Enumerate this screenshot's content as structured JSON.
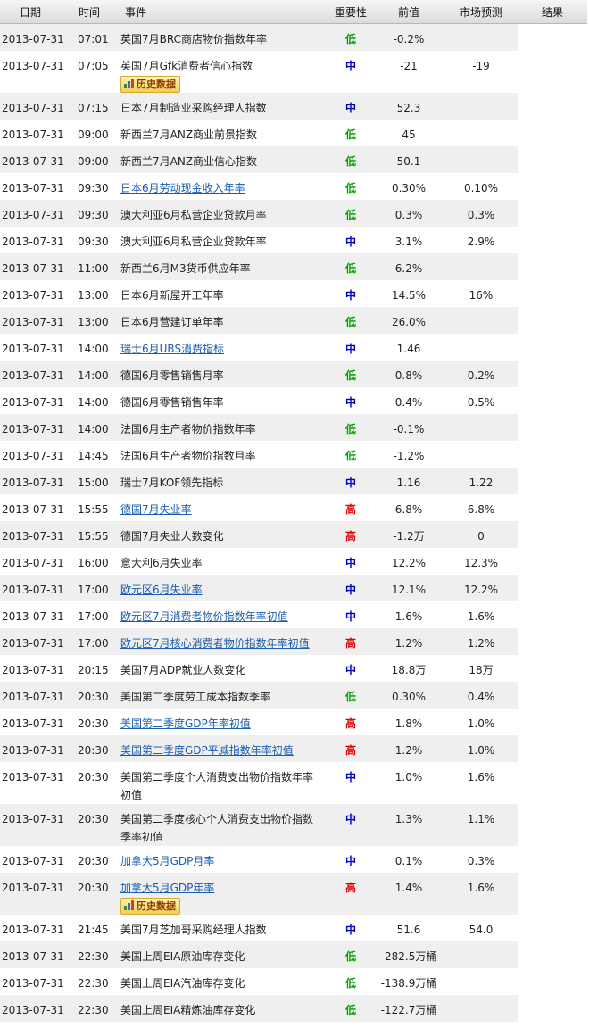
{
  "header": {
    "date": "日期",
    "time": "时间",
    "event": "事件",
    "importance": "重要性",
    "previous": "前值",
    "forecast": "市场预测",
    "result": "结果"
  },
  "history_label": "历史数据",
  "rows": [
    {
      "date": "2013-07-31",
      "time": "07:01",
      "event": "英国7月BRC商店物价指数年率",
      "link": false,
      "imp": "低",
      "lvl": "low",
      "prev": "-0.2%",
      "fc": "",
      "res": ""
    },
    {
      "date": "2013-07-31",
      "time": "07:05",
      "event": "英国7月Gfk消费者信心指数",
      "link": false,
      "imp": "中",
      "lvl": "mid",
      "prev": "-21",
      "fc": "-19",
      "res": "",
      "hist": true
    },
    {
      "date": "2013-07-31",
      "time": "07:15",
      "event": "日本7月制造业采购经理人指数",
      "link": false,
      "imp": "中",
      "lvl": "mid",
      "prev": "52.3",
      "fc": "",
      "res": ""
    },
    {
      "date": "2013-07-31",
      "time": "09:00",
      "event": "新西兰7月ANZ商业前景指数",
      "link": false,
      "imp": "低",
      "lvl": "low",
      "prev": "45",
      "fc": "",
      "res": ""
    },
    {
      "date": "2013-07-31",
      "time": "09:00",
      "event": "新西兰7月ANZ商业信心指数",
      "link": false,
      "imp": "低",
      "lvl": "low",
      "prev": "50.1",
      "fc": "",
      "res": ""
    },
    {
      "date": "2013-07-31",
      "time": "09:30",
      "event": "日本6月劳动现金收入年率",
      "link": true,
      "imp": "低",
      "lvl": "low",
      "prev": "0.30%",
      "fc": "0.10%",
      "res": ""
    },
    {
      "date": "2013-07-31",
      "time": "09:30",
      "event": "澳大利亚6月私营企业贷款月率",
      "link": false,
      "imp": "低",
      "lvl": "low",
      "prev": "0.3%",
      "fc": "0.3%",
      "res": ""
    },
    {
      "date": "2013-07-31",
      "time": "09:30",
      "event": "澳大利亚6月私营企业贷款年率",
      "link": false,
      "imp": "中",
      "lvl": "mid",
      "prev": "3.1%",
      "fc": "2.9%",
      "res": ""
    },
    {
      "date": "2013-07-31",
      "time": "11:00",
      "event": "新西兰6月M3货币供应年率",
      "link": false,
      "imp": "低",
      "lvl": "low",
      "prev": "6.2%",
      "fc": "",
      "res": ""
    },
    {
      "date": "2013-07-31",
      "time": "13:00",
      "event": "日本6月新屋开工年率",
      "link": false,
      "imp": "中",
      "lvl": "mid",
      "prev": "14.5%",
      "fc": "16%",
      "res": ""
    },
    {
      "date": "2013-07-31",
      "time": "13:00",
      "event": "日本6月营建订单年率",
      "link": false,
      "imp": "低",
      "lvl": "low",
      "prev": "26.0%",
      "fc": "",
      "res": ""
    },
    {
      "date": "2013-07-31",
      "time": "14:00",
      "event": "瑞士6月UBS消费指标",
      "link": true,
      "imp": "中",
      "lvl": "mid",
      "prev": "1.46",
      "fc": "",
      "res": ""
    },
    {
      "date": "2013-07-31",
      "time": "14:00",
      "event": "德国6月零售销售月率",
      "link": false,
      "imp": "低",
      "lvl": "low",
      "prev": "0.8%",
      "fc": "0.2%",
      "res": ""
    },
    {
      "date": "2013-07-31",
      "time": "14:00",
      "event": "德国6月零售销售年率",
      "link": false,
      "imp": "中",
      "lvl": "mid",
      "prev": "0.4%",
      "fc": "0.5%",
      "res": ""
    },
    {
      "date": "2013-07-31",
      "time": "14:00",
      "event": "法国6月生产者物价指数年率",
      "link": false,
      "imp": "低",
      "lvl": "low",
      "prev": "-0.1%",
      "fc": "",
      "res": ""
    },
    {
      "date": "2013-07-31",
      "time": "14:45",
      "event": "法国6月生产者物价指数月率",
      "link": false,
      "imp": "低",
      "lvl": "low",
      "prev": "-1.2%",
      "fc": "",
      "res": ""
    },
    {
      "date": "2013-07-31",
      "time": "15:00",
      "event": "瑞士7月KOF领先指标",
      "link": false,
      "imp": "中",
      "lvl": "mid",
      "prev": "1.16",
      "fc": "1.22",
      "res": ""
    },
    {
      "date": "2013-07-31",
      "time": "15:55",
      "event": "德国7月失业率",
      "link": true,
      "imp": "高",
      "lvl": "high",
      "prev": "6.8%",
      "fc": "6.8%",
      "res": ""
    },
    {
      "date": "2013-07-31",
      "time": "15:55",
      "event": "德国7月失业人数变化",
      "link": false,
      "imp": "高",
      "lvl": "high",
      "prev": "-1.2万",
      "fc": "0",
      "res": ""
    },
    {
      "date": "2013-07-31",
      "time": "16:00",
      "event": "意大利6月失业率",
      "link": false,
      "imp": "中",
      "lvl": "mid",
      "prev": "12.2%",
      "fc": "12.3%",
      "res": ""
    },
    {
      "date": "2013-07-31",
      "time": "17:00",
      "event": "欧元区6月失业率",
      "link": true,
      "imp": "中",
      "lvl": "mid",
      "prev": "12.1%",
      "fc": "12.2%",
      "res": ""
    },
    {
      "date": "2013-07-31",
      "time": "17:00",
      "event": "欧元区7月消费者物价指数年率初值",
      "link": true,
      "imp": "中",
      "lvl": "mid",
      "prev": "1.6%",
      "fc": "1.6%",
      "res": ""
    },
    {
      "date": "2013-07-31",
      "time": "17:00",
      "event": "欧元区7月核心消费者物价指数年率初值",
      "link": true,
      "imp": "高",
      "lvl": "high",
      "prev": "1.2%",
      "fc": "1.2%",
      "res": ""
    },
    {
      "date": "2013-07-31",
      "time": "20:15",
      "event": "美国7月ADP就业人数变化",
      "link": false,
      "imp": "中",
      "lvl": "mid",
      "prev": "18.8万",
      "fc": "18万",
      "res": ""
    },
    {
      "date": "2013-07-31",
      "time": "20:30",
      "event": "美国第二季度劳工成本指数季率",
      "link": false,
      "imp": "低",
      "lvl": "low",
      "prev": "0.30%",
      "fc": "0.4%",
      "res": ""
    },
    {
      "date": "2013-07-31",
      "time": "20:30",
      "event": "美国第二季度GDP年率初值",
      "link": true,
      "imp": "高",
      "lvl": "high",
      "prev": "1.8%",
      "fc": "1.0%",
      "res": ""
    },
    {
      "date": "2013-07-31",
      "time": "20:30",
      "event": "美国第二季度GDP平减指数年率初值",
      "link": true,
      "imp": "高",
      "lvl": "high",
      "prev": "1.2%",
      "fc": "1.0%",
      "res": ""
    },
    {
      "date": "2013-07-31",
      "time": "20:30",
      "event": "美国第二季度个人消费支出物价指数年率初值",
      "link": false,
      "imp": "中",
      "lvl": "mid",
      "prev": "1.0%",
      "fc": "1.6%",
      "res": "",
      "tall": true
    },
    {
      "date": "2013-07-31",
      "time": "20:30",
      "event": "美国第二季度核心个人消费支出物价指数季率初值",
      "link": false,
      "imp": "中",
      "lvl": "mid",
      "prev": "1.3%",
      "fc": "1.1%",
      "res": "",
      "tall": true
    },
    {
      "date": "2013-07-31",
      "time": "20:30",
      "event": "加拿大5月GDP月率",
      "link": true,
      "imp": "中",
      "lvl": "mid",
      "prev": "0.1%",
      "fc": "0.3%",
      "res": ""
    },
    {
      "date": "2013-07-31",
      "time": "20:30",
      "event": "加拿大5月GDP年率",
      "link": true,
      "imp": "高",
      "lvl": "high",
      "prev": "1.4%",
      "fc": "1.6%",
      "res": "",
      "hist": true
    },
    {
      "date": "2013-07-31",
      "time": "21:45",
      "event": "美国7月芝加哥采购经理人指数",
      "link": false,
      "imp": "中",
      "lvl": "mid",
      "prev": "51.6",
      "fc": "54.0",
      "res": ""
    },
    {
      "date": "2013-07-31",
      "time": "22:30",
      "event": "美国上周EIA原油库存变化",
      "link": false,
      "imp": "低",
      "lvl": "low",
      "prev": "-282.5万桶",
      "fc": "",
      "res": ""
    },
    {
      "date": "2013-07-31",
      "time": "22:30",
      "event": "美国上周EIA汽油库存变化",
      "link": false,
      "imp": "低",
      "lvl": "low",
      "prev": "-138.9万桶",
      "fc": "",
      "res": ""
    },
    {
      "date": "2013-07-31",
      "time": "22:30",
      "event": "美国上周EIA精炼油库存变化",
      "link": false,
      "imp": "低",
      "lvl": "low",
      "prev": "-122.7万桶",
      "fc": "",
      "res": ""
    }
  ]
}
